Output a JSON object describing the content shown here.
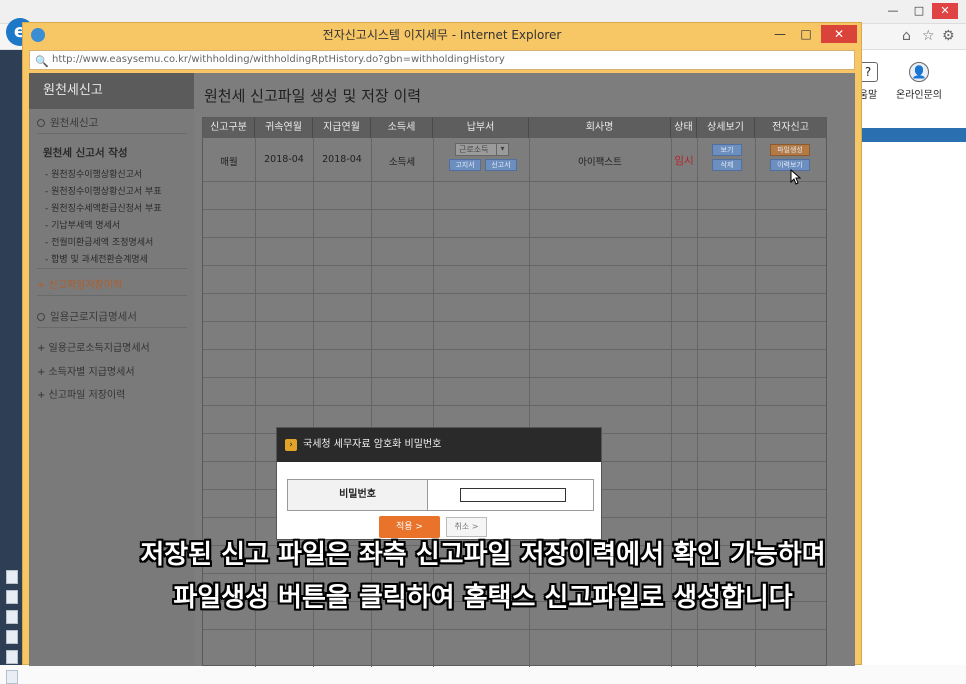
{
  "background_browser": {
    "toolbar_items": [
      {
        "label": "움말",
        "icon": "help-icon"
      },
      {
        "label": "온라인문의",
        "icon": "chat-icon"
      }
    ],
    "window_controls": [
      "—",
      "□",
      "✕"
    ]
  },
  "popup": {
    "title": "전자신고시스템 이지세무 - Internet Explorer",
    "url": "http://www.easysemu.co.kr/withholding/withholdingRptHistory.do?gbn=withholdingHistory",
    "controls": [
      "—",
      "□",
      "✕"
    ]
  },
  "sidebar": {
    "title": "원천세신고",
    "items": [
      {
        "label": "원천세신고",
        "kind": "section"
      },
      {
        "label": "원천세 신고서 작성",
        "kind": "bold"
      },
      {
        "label": "- 원천징수이행상황신고서",
        "kind": "sub"
      },
      {
        "label": "- 원천징수이행상황신고서 부표",
        "kind": "sub"
      },
      {
        "label": "- 원천징수세액환급신청서 부표",
        "kind": "sub"
      },
      {
        "label": "- 기납부세액 명세서",
        "kind": "sub"
      },
      {
        "label": "- 전월미환급세액 조정명세서",
        "kind": "sub"
      },
      {
        "label": "- 합병 및 과세전환승계명세",
        "kind": "sub"
      },
      {
        "label": "+ 신고파일저장이력",
        "kind": "active"
      },
      {
        "label": "일용근로지급명세서",
        "kind": "section"
      },
      {
        "label": "+ 일용근로소득지급명세서",
        "kind": "gray"
      },
      {
        "label": "+ 소득자별 지급명세서",
        "kind": "gray"
      },
      {
        "label": "+ 신고파일 저장이력",
        "kind": "gray"
      }
    ]
  },
  "main": {
    "title": "원천세 신고파일 생성 및 저장 이력",
    "columns": [
      "신고구분",
      "귀속연월",
      "지급연월",
      "소득세",
      "납부서",
      "회사명",
      "상태",
      "상세보기",
      "전자신고"
    ],
    "rows": [
      {
        "type": "매월",
        "attribution_month": "2018-04",
        "payment_month": "2018-04",
        "income_tax": "소득세",
        "bill_select": "근로소득",
        "bill_buttons": [
          "고지서",
          "신고서"
        ],
        "company": "아이팩스트",
        "status": "임시",
        "detail_buttons": [
          "보기",
          "삭제"
        ],
        "efile_buttons": [
          "파일생성",
          "이력보기"
        ]
      }
    ]
  },
  "password_dialog": {
    "title": "국세청 세무자료 암호화 비밀번호",
    "label": "비밀번호",
    "value": "",
    "ok_label": "적용 >",
    "cancel_label": "취소 >"
  },
  "subtitles": {
    "line1": "저장된 신고 파일은 좌측 신고파일 저장이력에서 확인 가능하며",
    "line2": "파일생성 버튼을 클릭하여 홈택스 신고파일로 생성합니다"
  },
  "colors": {
    "popup_frame": "#f7c766",
    "ok_button": "#e9732b",
    "status_red": "#b3262a",
    "active_link": "#b05d2a"
  }
}
